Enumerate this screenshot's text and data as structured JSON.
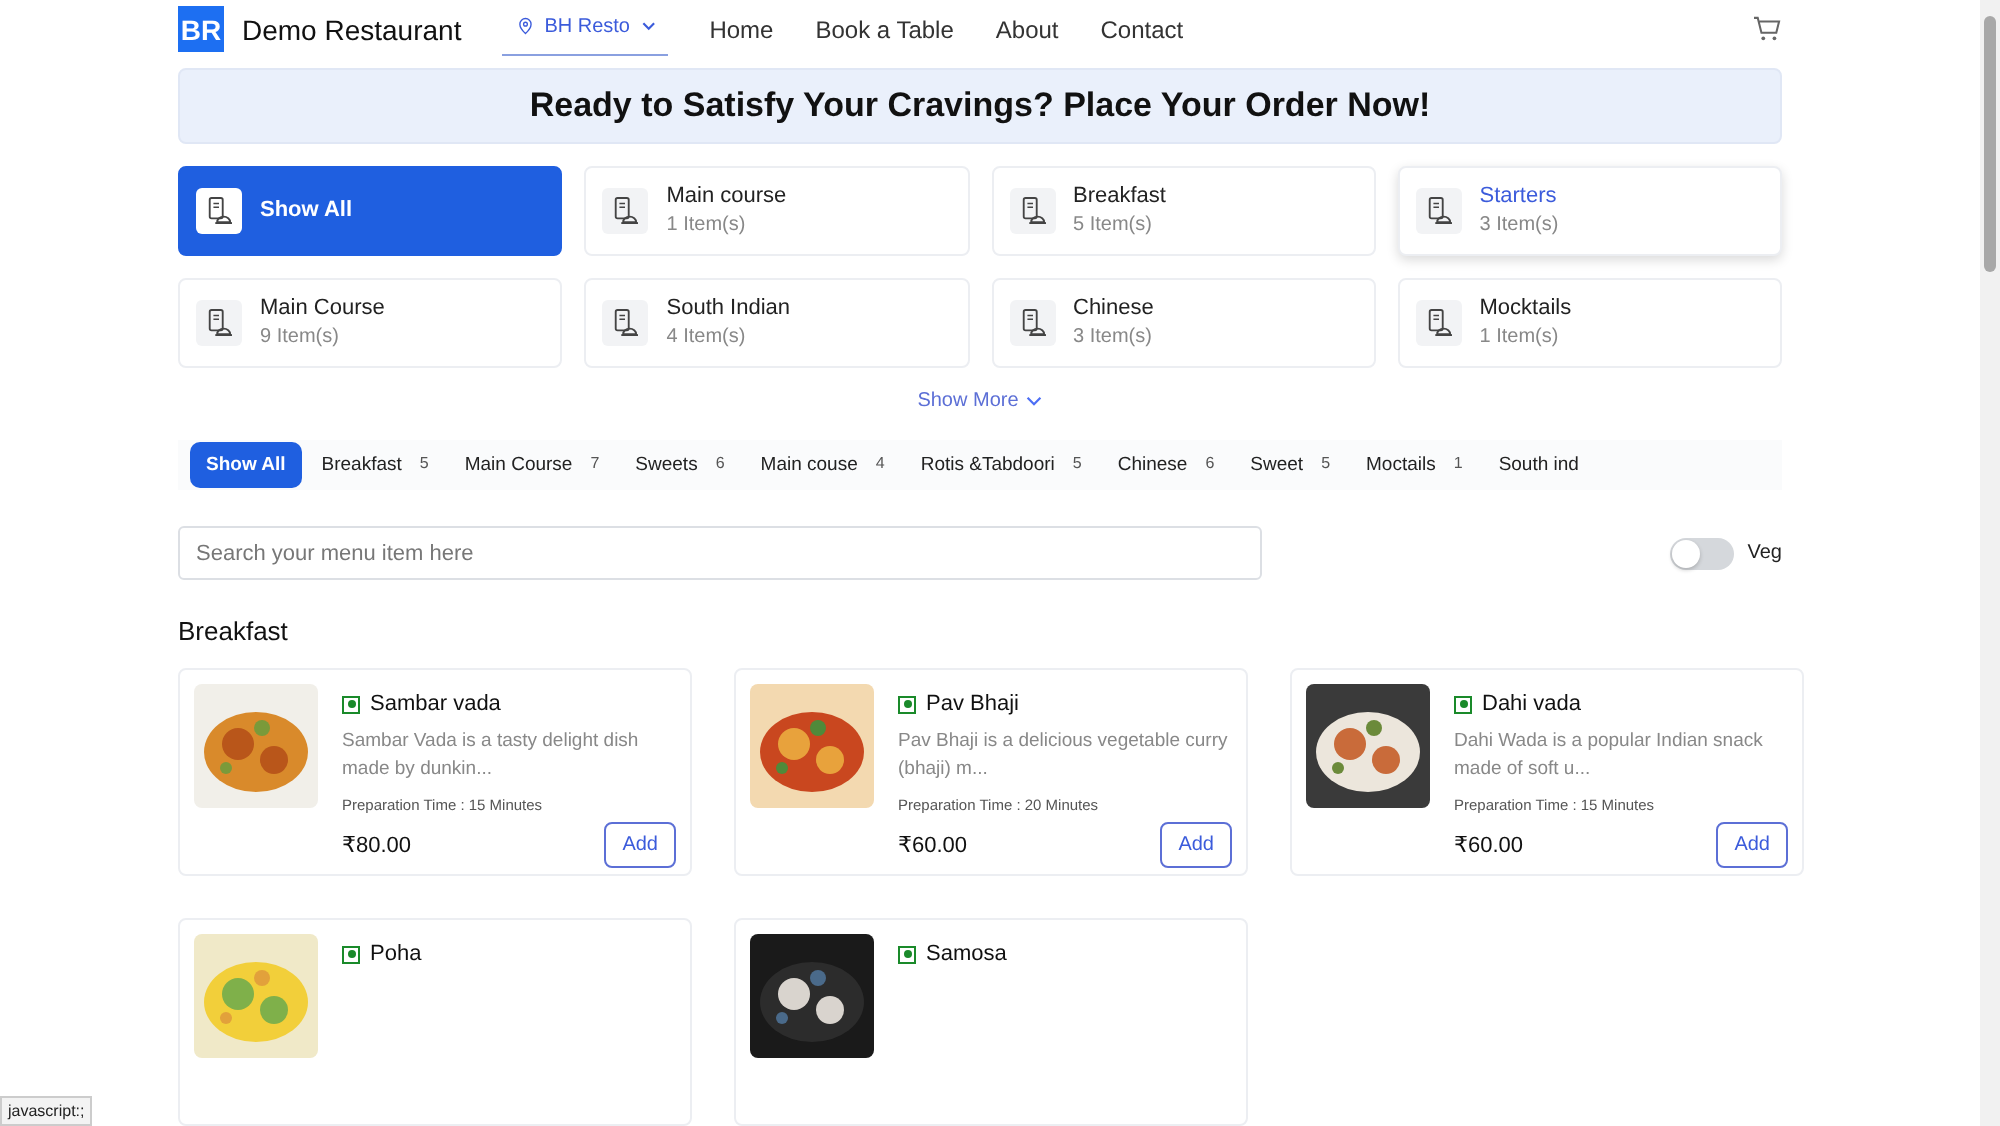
{
  "header": {
    "logo": "BR",
    "name": "Demo Restaurant",
    "location": "BH Resto",
    "nav": [
      {
        "label": "Home"
      },
      {
        "label": "Book a Table"
      },
      {
        "label": "About"
      },
      {
        "label": "Contact"
      }
    ]
  },
  "banner": {
    "title": "Ready to Satisfy Your Cravings? Place Your Order Now!"
  },
  "categories": [
    {
      "name": "Show All",
      "selected": true,
      "hovered": false
    },
    {
      "name": "Main course",
      "count": "1 Item(s)",
      "selected": false,
      "hovered": false
    },
    {
      "name": "Breakfast",
      "count": "5 Item(s)",
      "selected": false,
      "hovered": false
    },
    {
      "name": "Starters",
      "count": "3 Item(s)",
      "selected": false,
      "hovered": true
    },
    {
      "name": "Main Course",
      "count": "9 Item(s)",
      "selected": false,
      "hovered": false
    },
    {
      "name": "South Indian",
      "count": "4 Item(s)",
      "selected": false,
      "hovered": false
    },
    {
      "name": "Chinese",
      "count": "3 Item(s)",
      "selected": false,
      "hovered": false
    },
    {
      "name": "Mocktails",
      "count": "1 Item(s)",
      "selected": false,
      "hovered": false
    }
  ],
  "show_more": "Show More",
  "chips": [
    {
      "label": "Show All",
      "selected": true
    },
    {
      "label": "Breakfast",
      "count": "5",
      "selected": false
    },
    {
      "label": "Main Course",
      "count": "7",
      "selected": false
    },
    {
      "label": "Sweets",
      "count": "6",
      "selected": false
    },
    {
      "label": "Main couse",
      "count": "4",
      "selected": false
    },
    {
      "label": "Rotis &Tabdoori",
      "count": "5",
      "selected": false
    },
    {
      "label": "Chinese",
      "count": "6",
      "selected": false
    },
    {
      "label": "Sweet",
      "count": "5",
      "selected": false
    },
    {
      "label": "Moctails",
      "count": "1",
      "selected": false
    },
    {
      "label": "South ind",
      "selected": false
    }
  ],
  "search": {
    "placeholder": "Search your menu item here"
  },
  "veg_toggle": {
    "label": "Veg",
    "on": false
  },
  "section_title": "Breakfast",
  "items": [
    {
      "name": "Sambar vada",
      "description": "Sambar Vada is a tasty delight dish made by dunkin...",
      "prep": "Preparation Time : 15 Minutes",
      "price": "₹80.00",
      "add": "Add",
      "veg": true
    },
    {
      "name": "Pav Bhaji",
      "description": "Pav Bhaji is a delicious vegetable curry (bhaji) m...",
      "prep": "Preparation Time : 20 Minutes",
      "price": "₹60.00",
      "add": "Add",
      "veg": true
    },
    {
      "name": "Dahi vada",
      "description": "Dahi Wada is a popular Indian snack made of soft u...",
      "prep": "Preparation Time : 15 Minutes",
      "price": "₹60.00",
      "add": "Add",
      "veg": true
    },
    {
      "name": "Poha",
      "veg": true
    },
    {
      "name": "Samosa",
      "veg": true
    }
  ],
  "status_link": "javascript:;"
}
